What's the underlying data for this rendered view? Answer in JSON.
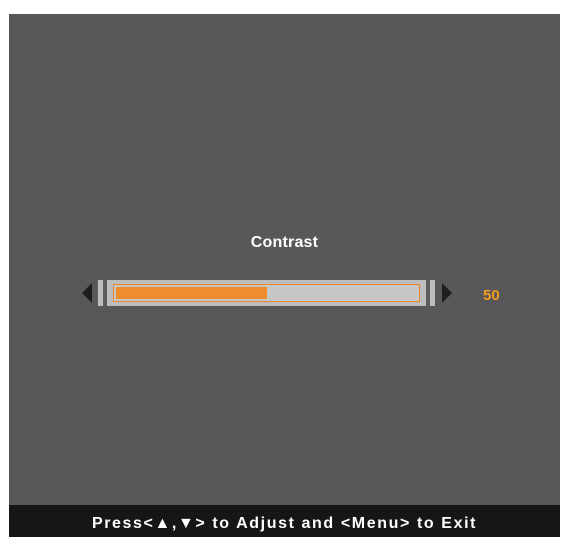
{
  "osd": {
    "title": "Contrast",
    "value": "50",
    "level_percent": 50,
    "help_text": "Press<▲,▼> to Adjust and <Menu> to Exit"
  },
  "colors": {
    "background": "#58585a",
    "accent": "#ef8c2e",
    "value_text": "#f39a1e",
    "footer_bg": "#161616"
  },
  "icons": {
    "left_arrow": "triangle-left-icon",
    "right_arrow": "triangle-right-icon"
  }
}
